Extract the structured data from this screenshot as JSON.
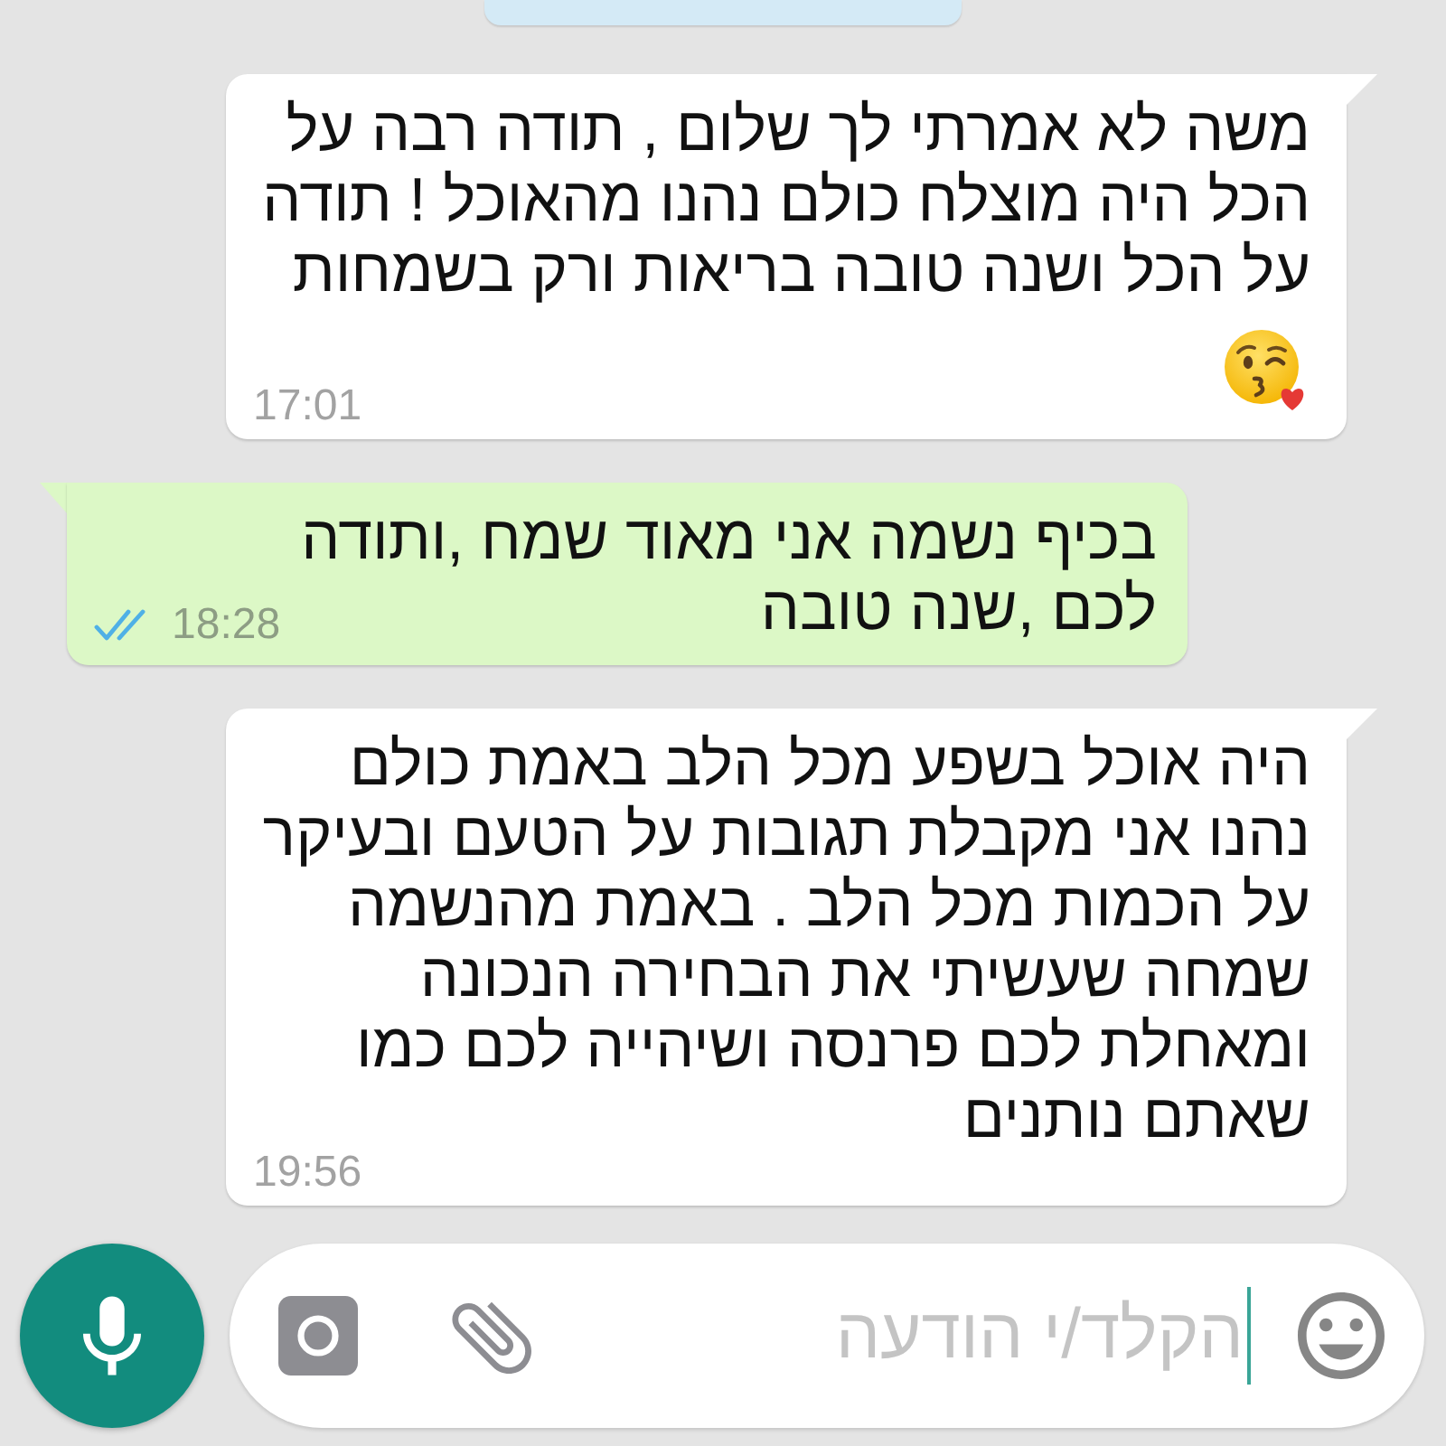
{
  "messages": [
    {
      "kind": "incoming",
      "text": "משה לא אמרתי לך שלום , תודה רבה על\nהכל היה מוצלח כולם נהנו מהאוכל ! תודה\nעל הכל ושנה טובה בריאות ורק בשמחות",
      "emojis": [
        {
          "kind": "kissing-face"
        }
      ],
      "time": "17:01"
    },
    {
      "kind": "outgoing",
      "text": "בכיף נשמה אני מאוד שמח ,ותודה\nלכם ,שנה טובה",
      "time": "18:28",
      "read": true
    },
    {
      "kind": "incoming",
      "text": "היה אוכל בשפע מכל הלב באמת כולם\nנהנו אני מקבלת תגובות על הטעם ובעיקר\nעל הכמות מכל הלב . באמת מהנשמה\nשמחה שעשיתי את הבחירה הנכונה\nומאחלת לכם פרנסה ושיהייה לכם כמו\nשאתם נותנים",
      "time": "19:56"
    }
  ],
  "composer": {
    "placeholder": "הקלד/י הודעה",
    "focused": true
  }
}
